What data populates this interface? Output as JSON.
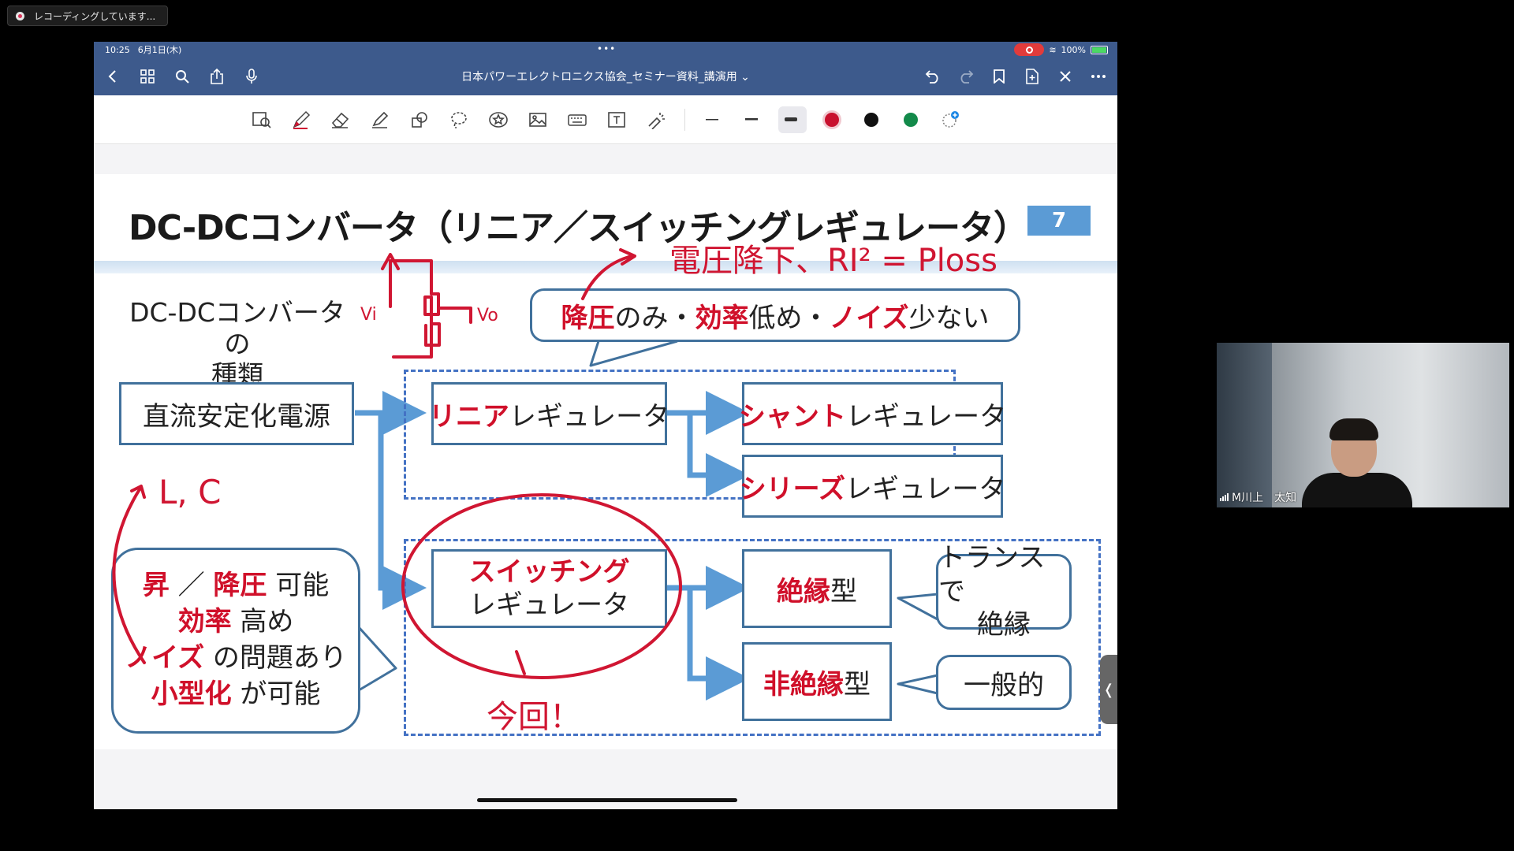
{
  "recording": {
    "label": "レコーディングしています..."
  },
  "status": {
    "time": "10:25",
    "date": "6月1日(木)",
    "battery": "100%"
  },
  "nav": {
    "title": "日本パワーエレクトロニクス協会_セミナー資料_講演用 ⌄"
  },
  "slide": {
    "title": "DC-DCコンバータ（リニア／スイッチングレギュレータ）",
    "number": "7",
    "types_label": "DC-DCコンバータの\n種類",
    "source_box": "直流安定化電源",
    "linear": {
      "red": "リニア",
      "rest": " レギュレータ"
    },
    "shunt": {
      "red": "シャント",
      "rest": " レギュレータ"
    },
    "series": {
      "red": "シリーズ",
      "rest": " レギュレータ"
    },
    "switching": {
      "line1": "スイッチング",
      "line2": "レギュレータ"
    },
    "insulated": {
      "red": "絶縁",
      "rest": " 型"
    },
    "non_insulated": {
      "red": "非絶縁",
      "rest": " 型"
    },
    "top_bubble": {
      "a": "降圧",
      "b": " のみ・",
      "c": "効率",
      "d": " 低め・",
      "e": "ノイズ",
      "f": " 少ない"
    },
    "left_bubble": {
      "l1a": "昇",
      "l1b": " ／ ",
      "l1c": "降圧",
      "l1d": " 可能",
      "l2a": "効率",
      "l2b": " 高め",
      "l3a": "ノイズ",
      "l3b": " の問題あり",
      "l4a": "小型化",
      "l4b": " が可能"
    },
    "trans_bubble": {
      "line1": "トランスで",
      "line2": "絶縁"
    },
    "general_bubble": "一般的"
  },
  "handwriting": {
    "top": "電圧降下、RI² = Ploss",
    "vin": "Vi",
    "vo": "Vo",
    "lc": "L, C",
    "now": "今回！"
  },
  "video": {
    "name": "M川上　太知"
  },
  "colors": {
    "accent_red": "#d0102a",
    "box_border": "#41719c",
    "dashed": "#4472c4",
    "ink": "#d01632",
    "nav": "#3d5a8c"
  }
}
